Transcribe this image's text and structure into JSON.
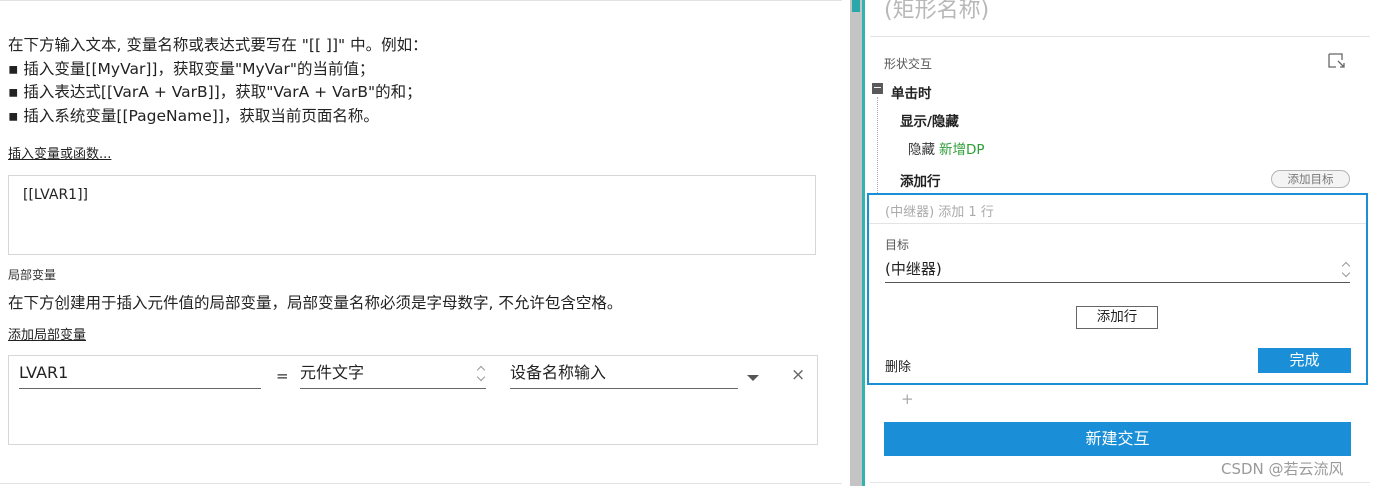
{
  "left": {
    "intro_lines": [
      "在下方输入文本, 变量名称或表达式要写在 \"[[ ]]\" 中。例如：",
      "▪ 插入变量[[MyVar]]，获取变量\"MyVar\"的当前值；",
      "▪ 插入表达式[[VarA + VarB]]，获取\"VarA + VarB\"的和；",
      "▪ 插入系统变量[[PageName]]，获取当前页面名称。"
    ],
    "insert_link": "插入变量或函数...",
    "text_value": "[[LVAR1]]",
    "local_vars_label": "局部变量",
    "local_vars_desc": "在下方创建用于插入元件值的局部变量，局部变量名称必须是字母数字, 不允许包含空格。",
    "add_local_var_link": "添加局部变量",
    "var_row": {
      "name": "LVAR1",
      "equals": "=",
      "type": "元件文字",
      "target": "设备名称输入",
      "close": "×"
    }
  },
  "right": {
    "shape_name": "(矩形名称)",
    "section_label": "形状交互",
    "event_toggle": "−",
    "event_label": "单击时",
    "action1_label": "显示/隐藏",
    "hide_verb": "隐藏",
    "hide_target": "新增DP",
    "action2_label": "添加行",
    "add_target_btn": "添加目标",
    "editor": {
      "header": "(中继器) 添加 1 行",
      "target_label": "目标",
      "target_value": "(中继器)",
      "add_row_btn": "添加行",
      "delete_label": "删除",
      "done_btn": "完成"
    },
    "plus": "+",
    "new_interaction_btn": "新建交互",
    "watermark": "CSDN @若云流风"
  },
  "colors": {
    "accent_blue": "#1a8ed6",
    "teal": "#34b2b0",
    "green_target": "#2e9e38"
  }
}
